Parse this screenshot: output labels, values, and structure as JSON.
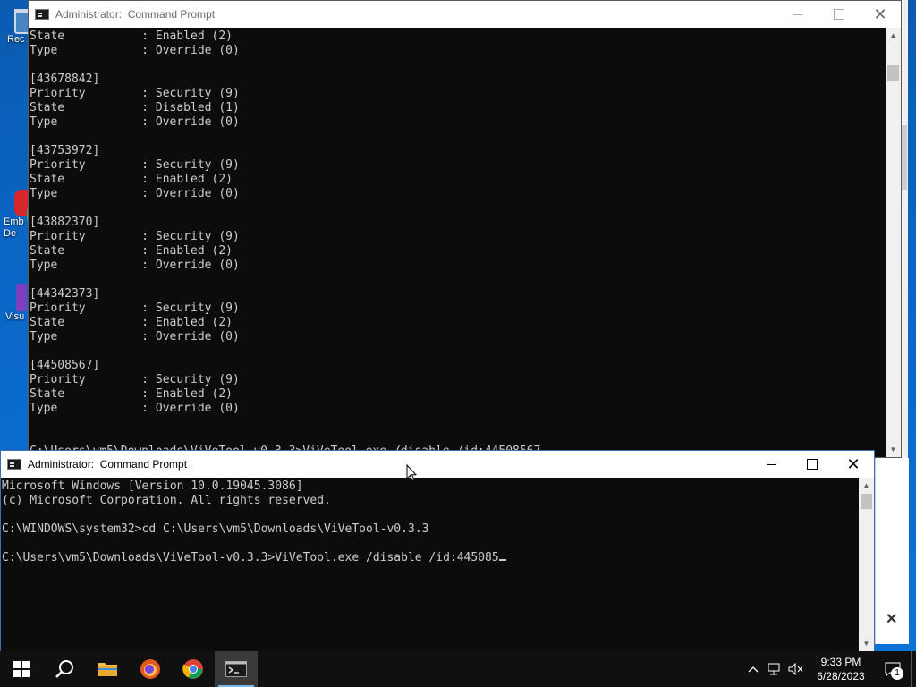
{
  "desktop": {
    "icons": [
      {
        "label": "Rec"
      },
      {
        "label": "Emb\nDe"
      },
      {
        "label": "Visu"
      }
    ]
  },
  "window_top": {
    "title": "Administrator:  Command Prompt",
    "console_lines": [
      "State           : Enabled (2)",
      "Type            : Override (0)",
      "",
      "[43678842]",
      "Priority        : Security (9)",
      "State           : Disabled (1)",
      "Type            : Override (0)",
      "",
      "[43753972]",
      "Priority        : Security (9)",
      "State           : Enabled (2)",
      "Type            : Override (0)",
      "",
      "[43882370]",
      "Priority        : Security (9)",
      "State           : Enabled (2)",
      "Type            : Override (0)",
      "",
      "[44342373]",
      "Priority        : Security (9)",
      "State           : Enabled (2)",
      "Type            : Override (0)",
      "",
      "[44508567]",
      "Priority        : Security (9)",
      "State           : Enabled (2)",
      "Type            : Override (0)",
      "",
      "",
      "C:\\Users\\vm5\\Downloads\\ViVeTool-v0.3.3>ViVeTool.exe /disable /id:44508567"
    ]
  },
  "window_bottom": {
    "title": "Administrator:  Command Prompt",
    "console_lines": [
      "Microsoft Windows [Version 10.0.19045.3086]",
      "(c) Microsoft Corporation. All rights reserved.",
      "",
      "C:\\WINDOWS\\system32>cd C:\\Users\\vm5\\Downloads\\ViVeTool-v0.3.3",
      "",
      "C:\\Users\\vm5\\Downloads\\ViVeTool-v0.3.3>ViVeTool.exe /disable /id:445085"
    ]
  },
  "behind_window": {
    "close_glyph": "✕"
  },
  "taskbar": {
    "apps": [
      {
        "name": "start",
        "active": false
      },
      {
        "name": "search",
        "active": false
      },
      {
        "name": "file-explorer",
        "active": false
      },
      {
        "name": "firefox",
        "active": false
      },
      {
        "name": "chrome",
        "active": false
      },
      {
        "name": "command-prompt",
        "active": true
      }
    ],
    "clock_time": "9:33 PM",
    "clock_date": "6/28/2023",
    "notification_count": "1"
  }
}
